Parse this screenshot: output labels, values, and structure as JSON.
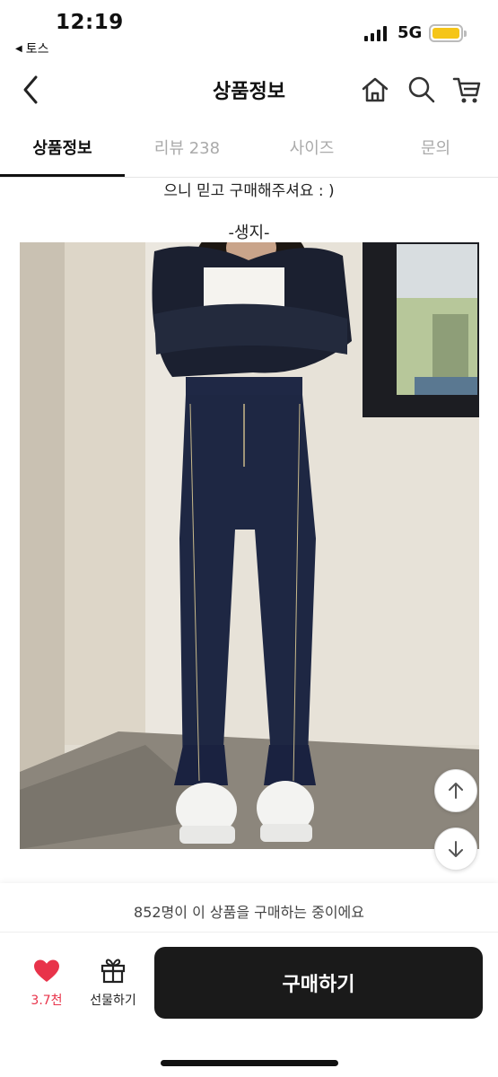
{
  "status": {
    "time": "12:19",
    "back_app": "토스",
    "network": "5G",
    "battery_color": "#f5c518"
  },
  "header": {
    "title": "상품정보",
    "icons": [
      "back-chevron-icon",
      "home-icon",
      "search-icon",
      "cart-icon"
    ]
  },
  "tabs": [
    {
      "label": "상품정보",
      "active": true
    },
    {
      "label": "리뷰 238",
      "active": false
    },
    {
      "label": "사이즈",
      "active": false
    },
    {
      "label": "문의",
      "active": false
    }
  ],
  "content": {
    "text_line": "으니 믿고 구매해주셔요 : )",
    "section_label": "-생지-"
  },
  "bottom": {
    "buyers_text": "852명이 이 상품을 구매하는 중이에요",
    "like_count": "3.7천",
    "gift_label": "선물하기",
    "buy_label": "구매하기",
    "like_color": "#e8334a",
    "buy_button_color": "#1a1a1a"
  }
}
